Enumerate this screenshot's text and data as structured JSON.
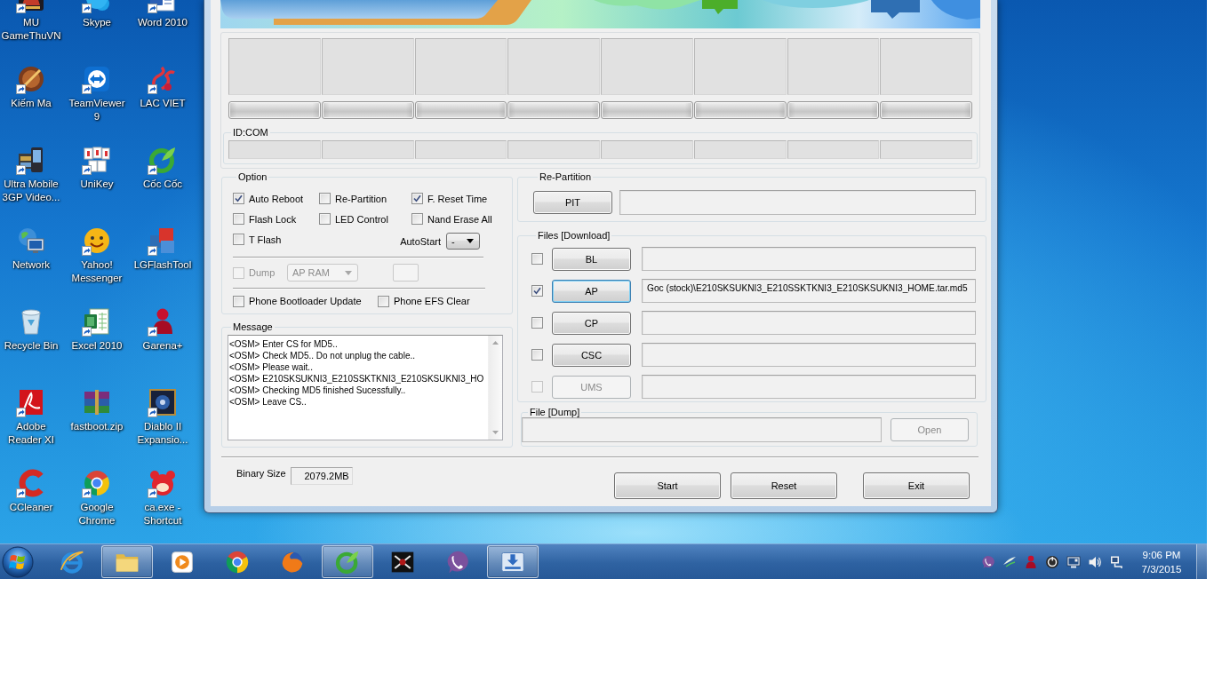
{
  "desktop": {
    "icons": [
      {
        "label": "MU GameThuVN",
        "shortcut": true
      },
      {
        "label": "Skype",
        "shortcut": true
      },
      {
        "label": "Word 2010",
        "shortcut": true
      },
      {
        "label": "Kiếm Ma",
        "shortcut": true
      },
      {
        "label": "TeamViewer 9",
        "shortcut": true
      },
      {
        "label": "LAC VIET",
        "shortcut": true
      },
      {
        "label": "Ultra Mobile 3GP Video...",
        "shortcut": true
      },
      {
        "label": "UniKey",
        "shortcut": true
      },
      {
        "label": "Cốc Cốc",
        "shortcut": true
      },
      {
        "label": "Network",
        "shortcut": false
      },
      {
        "label": "Yahoo! Messenger",
        "shortcut": true
      },
      {
        "label": "LGFlashTool",
        "shortcut": true
      },
      {
        "label": "Recycle Bin",
        "shortcut": false
      },
      {
        "label": "Excel 2010",
        "shortcut": true
      },
      {
        "label": "Garena+",
        "shortcut": true
      },
      {
        "label": "Adobe Reader XI",
        "shortcut": true
      },
      {
        "label": "fastboot.zip",
        "shortcut": false
      },
      {
        "label": "Diablo II Expansio...",
        "shortcut": true
      },
      {
        "label": "CCleaner",
        "shortcut": true
      },
      {
        "label": "Google Chrome",
        "shortcut": true
      },
      {
        "label": "ca.exe - Shortcut",
        "shortcut": true
      }
    ]
  },
  "odin": {
    "id_com": {
      "title": "ID:COM"
    },
    "option": {
      "title": "Option",
      "checks": [
        {
          "label": "Auto Reboot",
          "checked": true
        },
        {
          "label": "Re-Partition",
          "checked": false
        },
        {
          "label": "F. Reset Time",
          "checked": true
        },
        {
          "label": "Flash Lock",
          "checked": false
        },
        {
          "label": "LED Control",
          "checked": false
        },
        {
          "label": "Nand Erase All",
          "checked": false
        },
        {
          "label": "T Flash",
          "checked": false
        }
      ],
      "autostart": {
        "label": "AutoStart",
        "value": "-"
      },
      "dump": {
        "label": "Dump",
        "checked": false,
        "disabled": true,
        "target": "AP RAM"
      },
      "phone_checks": [
        {
          "label": "Phone Bootloader Update",
          "checked": false
        },
        {
          "label": "Phone EFS Clear",
          "checked": false
        }
      ]
    },
    "message": {
      "title": "Message",
      "lines": [
        "<OSM> Enter CS for MD5..",
        "<OSM> Check MD5.. Do not unplug the cable..",
        "<OSM> Please wait..",
        "<OSM> E210SKSUKNI3_E210SSKTKNI3_E210SKSUKNI3_HO",
        "<OSM> Checking MD5 finished Sucessfully..",
        "<OSM> Leave CS.."
      ]
    },
    "repartition": {
      "title": "Re-Partition",
      "button": "PIT"
    },
    "files": {
      "title": "Files [Download]",
      "rows": [
        {
          "button": "BL",
          "checked": false,
          "focused": false,
          "disabled": false
        },
        {
          "button": "AP",
          "checked": true,
          "focused": true,
          "disabled": false,
          "value": "Goc (stock)\\E210SKSUKNI3_E210SSKTKNI3_E210SKSUKNI3_HOME.tar.md5"
        },
        {
          "button": "CP",
          "checked": false,
          "focused": false,
          "disabled": false
        },
        {
          "button": "CSC",
          "checked": false,
          "focused": false,
          "disabled": false
        },
        {
          "button": "UMS",
          "checked": false,
          "focused": false,
          "disabled": true
        }
      ]
    },
    "file_dump": {
      "title": "File [Dump]",
      "button": "Open",
      "disabled": true
    },
    "binary_size": {
      "label": "Binary Size",
      "value": "2079.2MB"
    },
    "buttons": [
      "Start",
      "Reset",
      "Exit"
    ]
  },
  "taskbar": {
    "items": [
      {
        "running": false
      },
      {
        "running": true
      },
      {
        "running": false
      },
      {
        "running": false
      },
      {
        "running": false
      },
      {
        "running": true
      },
      {
        "running": false
      },
      {
        "running": false
      },
      {
        "running": true
      }
    ],
    "clock": {
      "time": "9:06 PM",
      "date": "7/3/2015"
    }
  }
}
